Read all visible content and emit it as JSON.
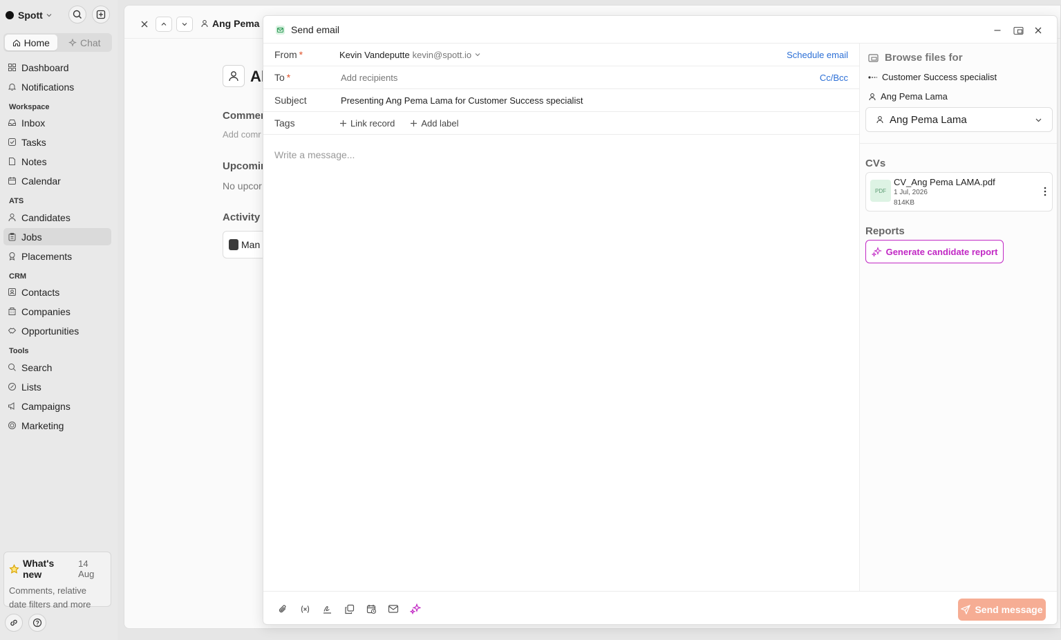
{
  "sidebar": {
    "brand": "Spott",
    "tabs": [
      {
        "label": "Home"
      },
      {
        "label": "Chat"
      }
    ],
    "nav": [
      {
        "label": "Dashboard",
        "icon": "grid-icon"
      },
      {
        "label": "Notifications",
        "icon": "bell-icon"
      }
    ],
    "sections": [
      {
        "title": "Workspace",
        "items": [
          {
            "label": "Inbox"
          },
          {
            "label": "Tasks"
          },
          {
            "label": "Notes"
          },
          {
            "label": "Calendar"
          }
        ]
      },
      {
        "title": "ATS",
        "items": [
          {
            "label": "Candidates"
          },
          {
            "label": "Jobs"
          },
          {
            "label": "Placements"
          }
        ]
      },
      {
        "title": "CRM",
        "items": [
          {
            "label": "Contacts"
          },
          {
            "label": "Companies"
          },
          {
            "label": "Opportunities"
          }
        ]
      },
      {
        "title": "Tools",
        "items": [
          {
            "label": "Search"
          },
          {
            "label": "Lists"
          },
          {
            "label": "Campaigns"
          },
          {
            "label": "Marketing"
          }
        ]
      }
    ],
    "whats_new": {
      "title": "What's new",
      "date": "14 Aug",
      "body": "Comments, relative date filters and more"
    }
  },
  "background": {
    "header_title": "Ang Pema L",
    "name_partial": "Al",
    "comments_label": "Commer",
    "comments_placeholder": "Add comr",
    "upcoming_label": "Upcomin",
    "upcoming_value": "No upcor",
    "activity_label": "Activity",
    "activity_card": "Man"
  },
  "modal": {
    "title": "Send email",
    "from": {
      "label": "From",
      "name": "Kevin Vandeputte",
      "email": "kevin@spott.io",
      "action": "Schedule email"
    },
    "to": {
      "label": "To",
      "placeholder": "Add recipients",
      "action": "Cc/Bcc"
    },
    "subject": {
      "label": "Subject",
      "value": "Presenting Ang Pema Lama for Customer Success specialist"
    },
    "tags": {
      "label": "Tags",
      "link_record": "Link record",
      "add_label": "Add label"
    },
    "message_placeholder": "Write a message...",
    "send_label": "Send message",
    "send_color": "#f6ad94"
  },
  "files": {
    "title": "Browse files for",
    "job": "Customer Success specialist",
    "candidate": "Ang Pema Lama",
    "selected": "Ang Pema Lama",
    "cvs_title": "CVs",
    "cv": {
      "badge": "PDF",
      "name": "CV_Ang Pema LAMA.pdf",
      "date": "1 Jul, 2026",
      "size": "814KB"
    },
    "reports_title": "Reports",
    "report_button": "Generate candidate report",
    "accent_color": "#c127c4"
  }
}
